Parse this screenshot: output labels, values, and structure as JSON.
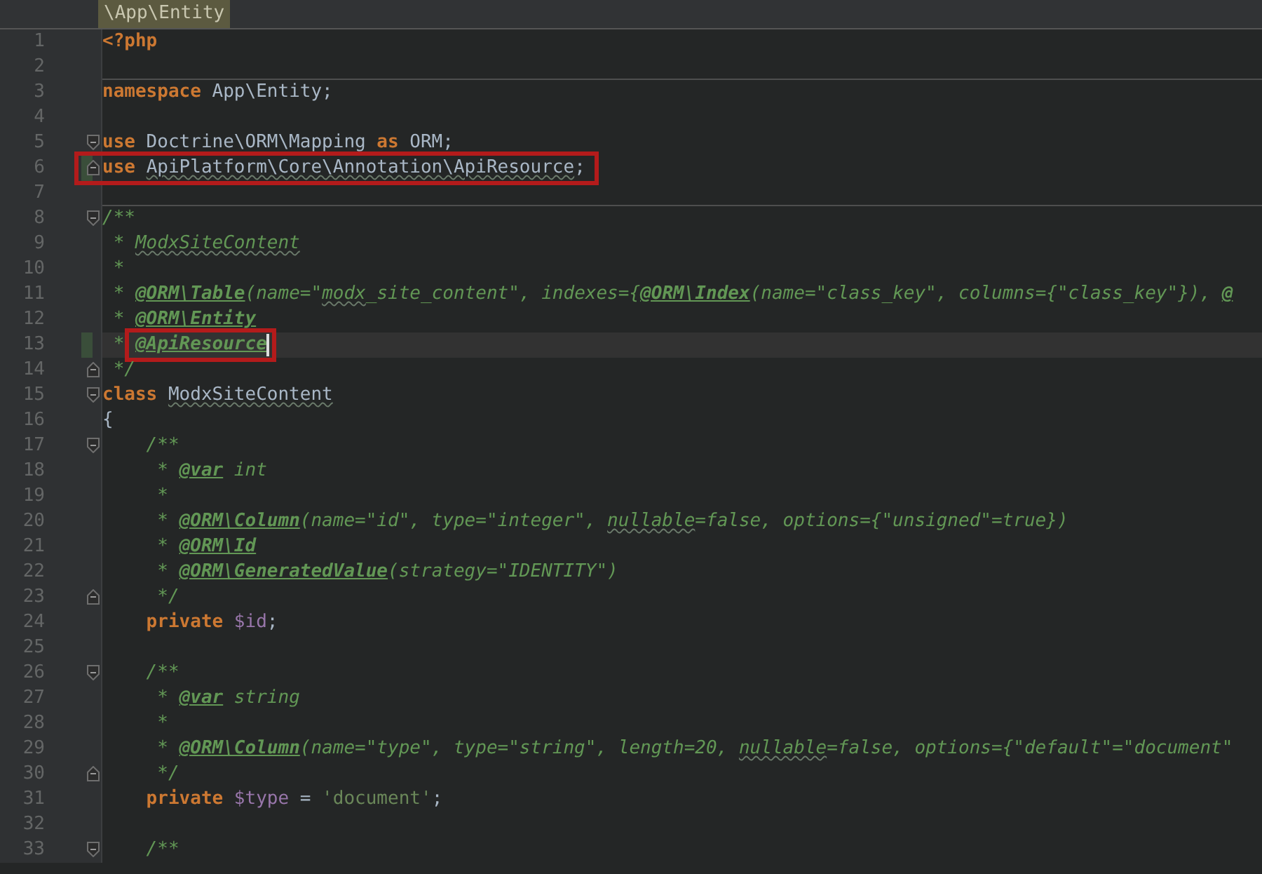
{
  "breadcrumb": "\\App\\Entity",
  "lines": [
    {
      "number": "1",
      "tokens": [
        {
          "kind": "keyword",
          "text": "<?php"
        }
      ]
    },
    {
      "number": "2"
    },
    {
      "number": "3",
      "separator_above": true,
      "tokens": [
        {
          "kind": "keyword",
          "text": "namespace"
        },
        {
          "kind": "plain",
          "text": " App\\Entity;"
        }
      ]
    },
    {
      "number": "4"
    },
    {
      "number": "5",
      "fold_start": true,
      "tokens": [
        {
          "kind": "keyword",
          "text": "use"
        },
        {
          "kind": "plain",
          "text": " Doctrine\\ORM\\Mapping "
        },
        {
          "kind": "keyword",
          "text": "as"
        },
        {
          "kind": "plain",
          "text": " ORM;"
        }
      ]
    },
    {
      "number": "6",
      "fold_end": true,
      "changed": true,
      "boxed": true,
      "tokens": [
        {
          "kind": "keyword",
          "text": "use "
        },
        {
          "kind": "plain",
          "text": "ApiPlatform\\Core\\Annotation\\ApiResource",
          "wavy": true
        },
        {
          "kind": "plain",
          "text": ";"
        }
      ]
    },
    {
      "number": "7"
    },
    {
      "number": "8",
      "fold_start": true,
      "separator_above": true,
      "tokens": [
        {
          "kind": "comment",
          "text": "/**"
        }
      ]
    },
    {
      "number": "9",
      "tokens": [
        {
          "kind": "comment",
          "text": " * "
        },
        {
          "kind": "comment",
          "text": "ModxSiteContent",
          "wavy": true
        }
      ]
    },
    {
      "number": "10",
      "tokens": [
        {
          "kind": "comment",
          "text": " *"
        }
      ]
    },
    {
      "number": "11",
      "tokens": [
        {
          "kind": "comment",
          "text": " * "
        },
        {
          "kind": "tag",
          "text": "@ORM\\Table"
        },
        {
          "kind": "comment",
          "text": "(name=\""
        },
        {
          "kind": "comment",
          "text": "modx",
          "wavy": true
        },
        {
          "kind": "comment",
          "text": "_site_content\", indexes={"
        },
        {
          "kind": "tag",
          "text": "@ORM\\Index"
        },
        {
          "kind": "comment",
          "text": "(name=\"class_key\", columns={\"class_key\"}), "
        },
        {
          "kind": "tag",
          "text": "@"
        }
      ]
    },
    {
      "number": "12",
      "tokens": [
        {
          "kind": "comment",
          "text": " * "
        },
        {
          "kind": "tag",
          "text": "@ORM\\Entity"
        }
      ]
    },
    {
      "number": "13",
      "current": true,
      "changed": true,
      "boxed": true,
      "caret": true,
      "tokens": [
        {
          "kind": "comment",
          "text": " * "
        },
        {
          "kind": "tag",
          "text": "@ApiResource"
        }
      ]
    },
    {
      "number": "14",
      "fold_end": true,
      "tokens": [
        {
          "kind": "comment",
          "text": " */"
        }
      ]
    },
    {
      "number": "15",
      "fold_start": true,
      "tokens": [
        {
          "kind": "keyword",
          "text": "class "
        },
        {
          "kind": "plain",
          "text": "ModxSiteContent",
          "wavy": true
        }
      ]
    },
    {
      "number": "16",
      "tokens": [
        {
          "kind": "plain",
          "text": "{"
        }
      ]
    },
    {
      "number": "17",
      "fold_start": true,
      "tokens": [
        {
          "kind": "comment",
          "text": "    /**"
        }
      ]
    },
    {
      "number": "18",
      "tokens": [
        {
          "kind": "comment",
          "text": "     * "
        },
        {
          "kind": "tag",
          "text": "@var"
        },
        {
          "kind": "comment",
          "text": " int"
        }
      ]
    },
    {
      "number": "19",
      "tokens": [
        {
          "kind": "comment",
          "text": "     *"
        }
      ]
    },
    {
      "number": "20",
      "tokens": [
        {
          "kind": "comment",
          "text": "     * "
        },
        {
          "kind": "tag",
          "text": "@ORM\\Column"
        },
        {
          "kind": "comment",
          "text": "(name=\"id\", type=\"integer\", "
        },
        {
          "kind": "comment",
          "text": "nullable",
          "wavy": true
        },
        {
          "kind": "comment",
          "text": "=false, options={\"unsigned\"=true})"
        }
      ]
    },
    {
      "number": "21",
      "tokens": [
        {
          "kind": "comment",
          "text": "     * "
        },
        {
          "kind": "tag",
          "text": "@ORM\\Id"
        }
      ]
    },
    {
      "number": "22",
      "tokens": [
        {
          "kind": "comment",
          "text": "     * "
        },
        {
          "kind": "tag",
          "text": "@ORM\\GeneratedValue"
        },
        {
          "kind": "comment",
          "text": "(strategy=\"IDENTITY\")"
        }
      ]
    },
    {
      "number": "23",
      "fold_end": true,
      "tokens": [
        {
          "kind": "comment",
          "text": "     */"
        }
      ]
    },
    {
      "number": "24",
      "tokens": [
        {
          "kind": "keyword",
          "text": "    private "
        },
        {
          "kind": "variable",
          "text": "$id"
        },
        {
          "kind": "plain",
          "text": ";"
        }
      ]
    },
    {
      "number": "25"
    },
    {
      "number": "26",
      "fold_start": true,
      "tokens": [
        {
          "kind": "comment",
          "text": "    /**"
        }
      ]
    },
    {
      "number": "27",
      "tokens": [
        {
          "kind": "comment",
          "text": "     * "
        },
        {
          "kind": "tag",
          "text": "@var"
        },
        {
          "kind": "comment",
          "text": " string"
        }
      ]
    },
    {
      "number": "28",
      "tokens": [
        {
          "kind": "comment",
          "text": "     *"
        }
      ]
    },
    {
      "number": "29",
      "tokens": [
        {
          "kind": "comment",
          "text": "     * "
        },
        {
          "kind": "tag",
          "text": "@ORM\\Column"
        },
        {
          "kind": "comment",
          "text": "(name=\"type\", type=\"string\", length=20, "
        },
        {
          "kind": "comment",
          "text": "nullable",
          "wavy": true
        },
        {
          "kind": "comment",
          "text": "=false, options={\"default\"=\"document\""
        }
      ]
    },
    {
      "number": "30",
      "fold_end": true,
      "tokens": [
        {
          "kind": "comment",
          "text": "     */"
        }
      ]
    },
    {
      "number": "31",
      "tokens": [
        {
          "kind": "keyword",
          "text": "    private "
        },
        {
          "kind": "variable",
          "text": "$type"
        },
        {
          "kind": "plain",
          "text": " = "
        },
        {
          "kind": "string",
          "text": "'document'"
        },
        {
          "kind": "plain",
          "text": ";"
        }
      ]
    },
    {
      "number": "32"
    },
    {
      "number": "33",
      "fold_start": true,
      "tokens": [
        {
          "kind": "comment",
          "text": "    /**"
        }
      ]
    }
  ]
}
